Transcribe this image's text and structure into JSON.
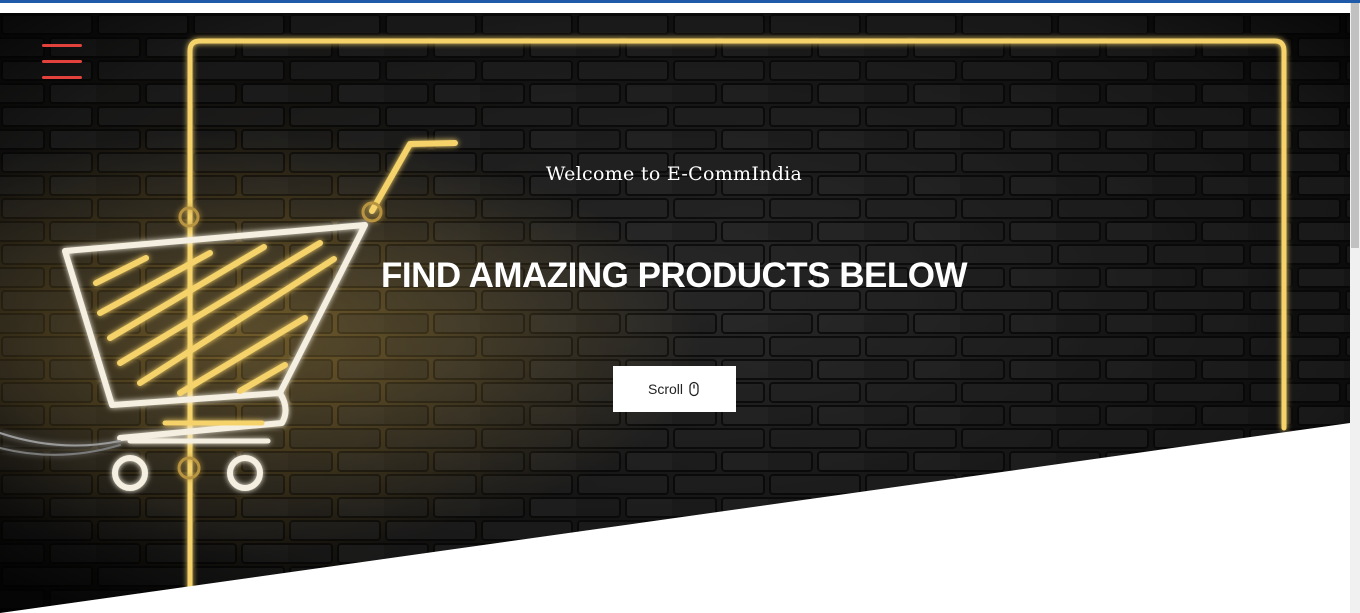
{
  "menu": {
    "icon": "hamburger-menu-icon",
    "color": "#e2423b"
  },
  "hero": {
    "welcome_text": "Welcome to E-CommIndia",
    "headline": "FIND AMAZING PRODUCTS BELOW",
    "scroll_button_label": "Scroll",
    "scroll_icon": "mouse-icon",
    "neon_color": "#f5d36a",
    "background_color": "#121212"
  }
}
